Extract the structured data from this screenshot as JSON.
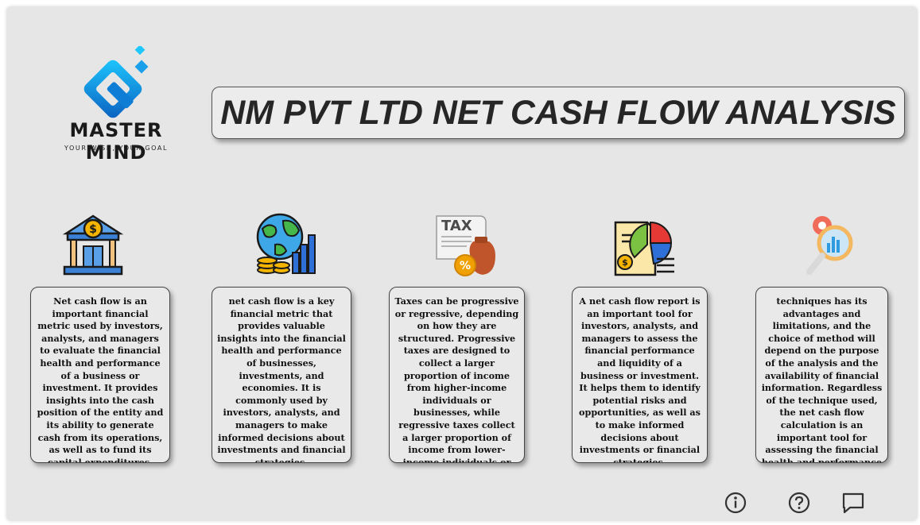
{
  "brand": {
    "name": "MASTER MIND",
    "tagline": "YOUR WISH, YOUR GOAL"
  },
  "title": "NM PVT LTD NET CASH FLOW ANALYSIS",
  "cards": [
    {
      "icon": "bank-dollar-icon",
      "text": "Net cash flow is an important financial metric used by investors, analysts, and managers to evaluate the financial health and performance of a business or investment. It provides insights into the cash position of the entity and its ability to generate cash from its operations, as well as to fund its capital expenditures, debt"
    },
    {
      "icon": "globe-growth-icon",
      "text": "net cash flow is a key financial metric that provides valuable insights into the financial health and performance of businesses, investments, and economies. It is commonly used by investors, analysts, and managers to make informed decisions about investments and financial strategies."
    },
    {
      "icon": "tax-document-icon",
      "text": "Taxes can be progressive or regressive, depending on how they are structured. Progressive taxes are designed to collect a larger proportion of income from higher-income individuals or businesses, while regressive taxes collect a larger proportion of income from lower-income individuals or businesses."
    },
    {
      "icon": "financial-report-icon",
      "text": "A net cash flow report is an important tool for investors, analysts, and managers to assess the financial performance and liquidity of a business or investment. It helps them to identify potential risks and opportunities, as well as to make informed decisions about investments or financial strategies."
    },
    {
      "icon": "analysis-magnifier-icon",
      "text": "techniques has its advantages and limitations, and the choice of method will depend on the purpose of the analysis and the availability of financial information. Regardless of the technique used, the net cash flow calculation is an important tool for assessing the financial health and performance"
    }
  ],
  "footer": [
    "info-icon",
    "help-icon",
    "comment-icon"
  ]
}
